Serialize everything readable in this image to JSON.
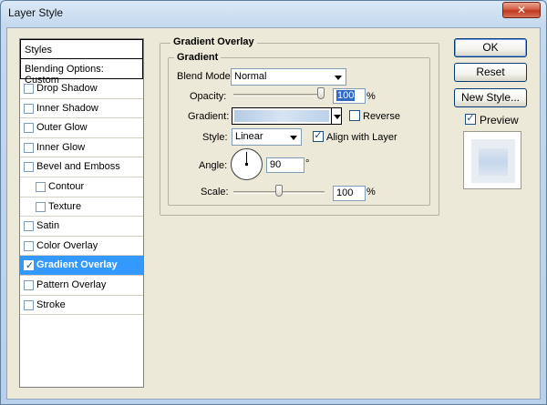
{
  "window": {
    "title": "Layer Style",
    "close_glyph": "✕"
  },
  "styles_list": {
    "header": "Styles",
    "blending": "Blending Options: Custom",
    "items": [
      {
        "label": "Drop Shadow",
        "checked": false,
        "sub": false
      },
      {
        "label": "Inner Shadow",
        "checked": false,
        "sub": false
      },
      {
        "label": "Outer Glow",
        "checked": false,
        "sub": false
      },
      {
        "label": "Inner Glow",
        "checked": false,
        "sub": false
      },
      {
        "label": "Bevel and Emboss",
        "checked": false,
        "sub": false
      },
      {
        "label": "Contour",
        "checked": false,
        "sub": true
      },
      {
        "label": "Texture",
        "checked": false,
        "sub": true
      },
      {
        "label": "Satin",
        "checked": false,
        "sub": false
      },
      {
        "label": "Color Overlay",
        "checked": false,
        "sub": false
      },
      {
        "label": "Gradient Overlay",
        "checked": true,
        "sub": false,
        "selected": true
      },
      {
        "label": "Pattern Overlay",
        "checked": false,
        "sub": false
      },
      {
        "label": "Stroke",
        "checked": false,
        "sub": false
      }
    ]
  },
  "panel": {
    "outer_title": "Gradient Overlay",
    "inner_title": "Gradient",
    "blend_mode": {
      "label": "Blend Mode:",
      "value": "Normal"
    },
    "opacity": {
      "label": "Opacity:",
      "value": "100",
      "unit": "%",
      "level": 100
    },
    "gradient": {
      "label": "Gradient:",
      "reverse_label": "Reverse",
      "reverse_checked": false
    },
    "style": {
      "label": "Style:",
      "value": "Linear",
      "align_label": "Align with Layer",
      "align_checked": true
    },
    "angle": {
      "label": "Angle:",
      "value": "90",
      "unit": "°"
    },
    "scale": {
      "label": "Scale:",
      "value": "100",
      "unit": "%",
      "level": 100
    }
  },
  "buttons": {
    "ok": "OK",
    "reset": "Reset",
    "new_style": "New Style...",
    "preview_label": "Preview",
    "preview_checked": true
  }
}
